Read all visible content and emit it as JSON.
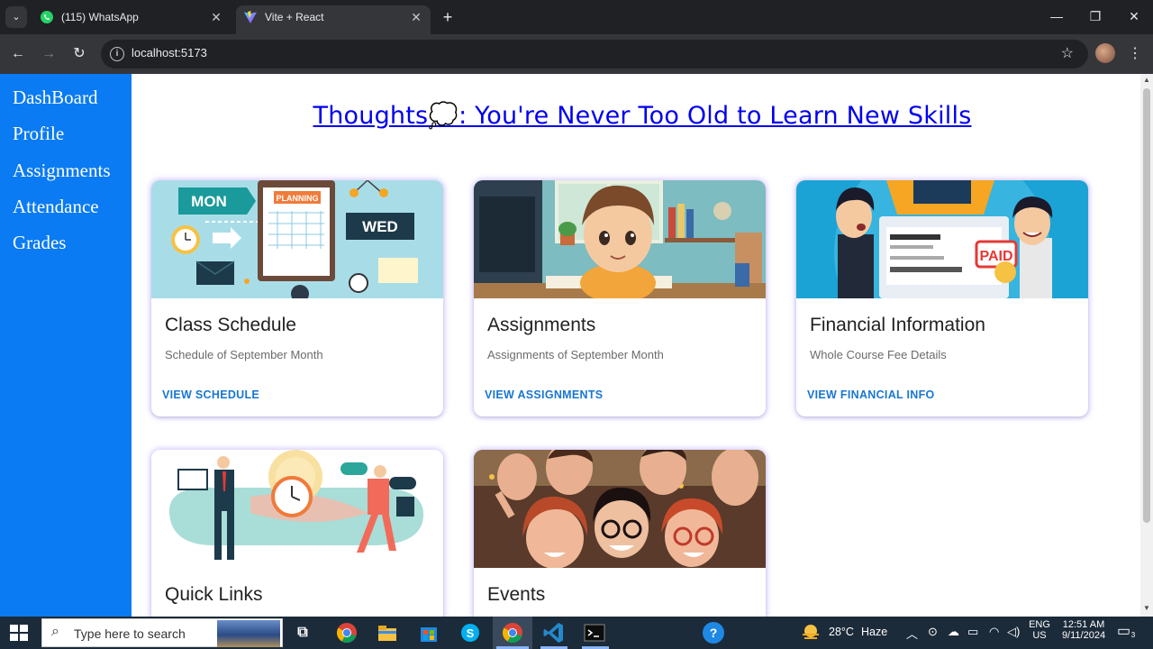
{
  "browser": {
    "tabs": [
      {
        "label": "(115) WhatsApp",
        "active": false,
        "icon": "whatsapp-icon"
      },
      {
        "label": "Vite + React",
        "active": true,
        "icon": "vite-icon"
      }
    ],
    "url": "localhost:5173"
  },
  "sidebar": {
    "items": [
      {
        "label": "DashBoard"
      },
      {
        "label": "Profile"
      },
      {
        "label": "Assignments"
      },
      {
        "label": "Attendance"
      },
      {
        "label": "Grades"
      }
    ]
  },
  "main": {
    "thought": "Thoughts💭: You're Never Too Old to Learn New Skills",
    "cards": [
      {
        "title": "Class Schedule",
        "description": "Schedule of September Month",
        "action": "VIEW SCHEDULE"
      },
      {
        "title": "Assignments",
        "description": "Assignments of September Month",
        "action": "VIEW ASSIGNMENTS"
      },
      {
        "title": "Financial Information",
        "description": "Whole Course Fee Details",
        "action": "VIEW FINANCIAL INFO"
      },
      {
        "title": "Quick Links"
      },
      {
        "title": "Events"
      }
    ],
    "schedule_art": {
      "day1": "MON",
      "day2": "WED",
      "note": "PLANNING"
    },
    "finance_art": {
      "stamp": "PAID"
    }
  },
  "taskbar": {
    "search_placeholder": "Type here to search",
    "weather": {
      "temp": "28°C",
      "condition": "Haze"
    },
    "language": {
      "lang": "ENG",
      "region": "US"
    },
    "clock": {
      "time": "12:51 AM",
      "date": "9/11/2024"
    },
    "notifications": "3"
  },
  "colors": {
    "sidebar": "#0a7bf2",
    "link": "#0000ee",
    "card_action": "#1976d2",
    "card_glow": "#9678ff"
  }
}
